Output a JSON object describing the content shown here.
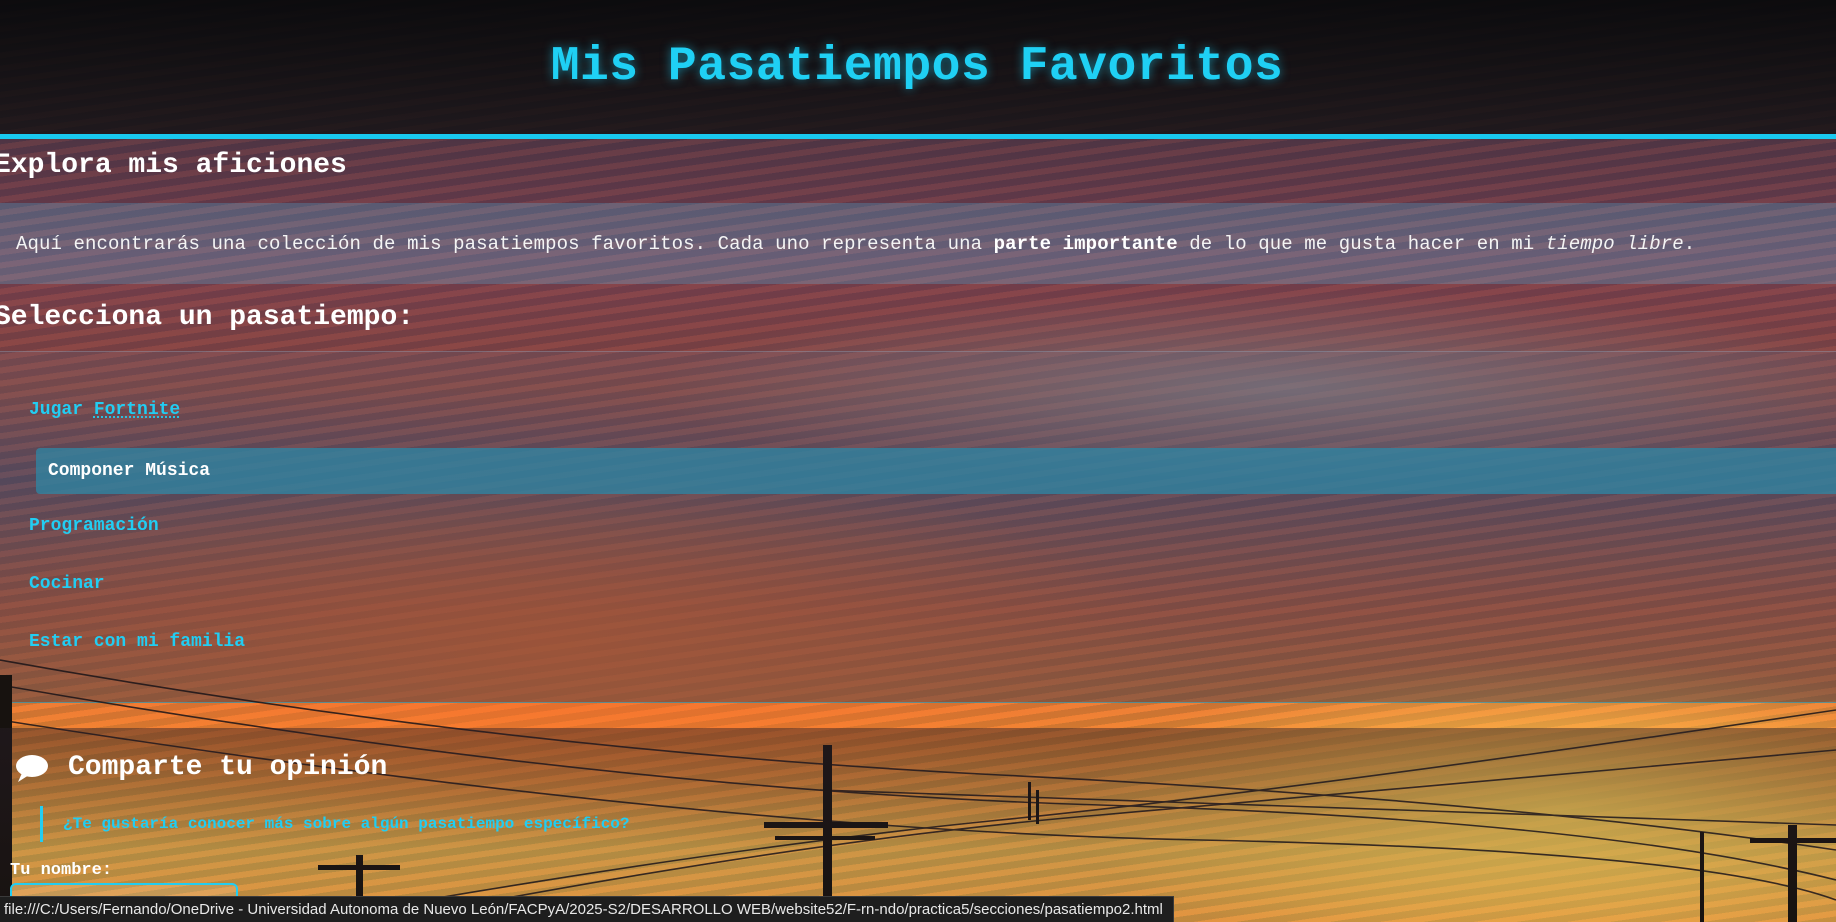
{
  "header": {
    "title": "Mis Pasatiempos Favoritos"
  },
  "explore": {
    "title": "Explora mis aficiones",
    "intro_before": "Aquí encontrarás una colección de mis pasatiempos favoritos. Cada uno representa una ",
    "intro_bold": "parte importante",
    "intro_middle": " de lo que me gusta hacer en mi ",
    "intro_italic": "tiempo libre",
    "intro_end": "."
  },
  "select": {
    "title": "Selecciona un pasatiempo:"
  },
  "hobbies": {
    "items": [
      {
        "label_prefix": "Jugar ",
        "label_suffix": "Fortnite"
      },
      {
        "label": "Componer Música",
        "active": true
      },
      {
        "label": "Programación"
      },
      {
        "label": "Cocinar"
      },
      {
        "label": "Estar con mi familia"
      }
    ]
  },
  "opinion": {
    "icon": "speech-bubble-icon",
    "title": "Comparte tu opinión",
    "question": "¿Te gustaría conocer más sobre algún pasatiempo específico?",
    "name_label": "Tu nombre:",
    "name_value": ""
  },
  "statusbar": {
    "url": "file:///C:/Users/Fernando/OneDrive - Universidad Autonoma de Nuevo León/FACPyA/2025-S2/DESARROLLO WEB/website52/F-rn-ndo/practica5/secciones/pasatiempo2.html"
  },
  "colors": {
    "accent": "#1fd0f4",
    "header_bg": "#0e0e10",
    "active_item_bg": "#2d87a5"
  }
}
